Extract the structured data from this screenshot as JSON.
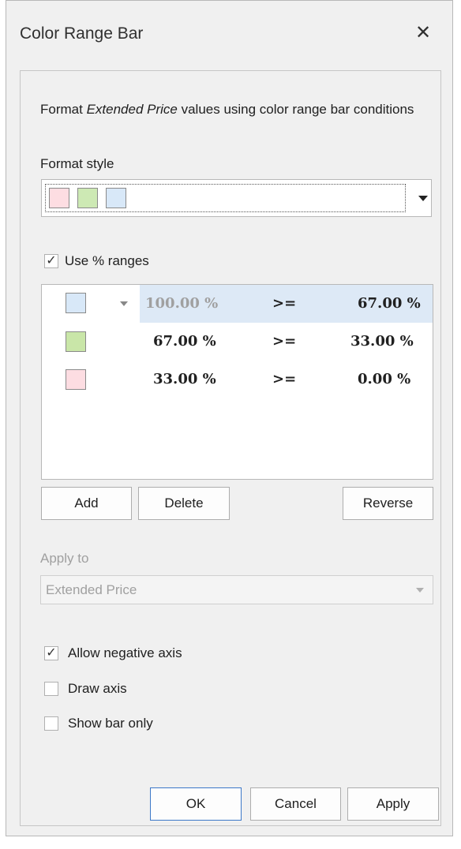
{
  "dialog": {
    "title": "Color Range Bar",
    "close_glyph": "✕"
  },
  "description": {
    "prefix": "Format ",
    "field": "Extended Price",
    "suffix": " values using color range bar conditions"
  },
  "format_style": {
    "label": "Format style",
    "swatches": [
      "#fddde2",
      "#cde9b4",
      "#d8e8f8"
    ]
  },
  "use_percent": {
    "label": "Use % ranges",
    "checked": true
  },
  "ranges": [
    {
      "color": "#d8e8f8",
      "from": "100.00 %",
      "op": ">=",
      "to": "67.00 %",
      "selected": true
    },
    {
      "color": "#c9e6a8",
      "from": "67.00 %",
      "op": ">=",
      "to": "33.00 %",
      "selected": false
    },
    {
      "color": "#fddde2",
      "from": "33.00 %",
      "op": ">=",
      "to": "0.00 %",
      "selected": false
    }
  ],
  "buttons": {
    "add": "Add",
    "delete": "Delete",
    "reverse": "Reverse"
  },
  "apply_to": {
    "label": "Apply to",
    "value": "Extended Price",
    "enabled": false
  },
  "options": [
    {
      "label": "Allow negative axis",
      "checked": true
    },
    {
      "label": "Draw axis",
      "checked": false
    },
    {
      "label": "Show bar only",
      "checked": false
    }
  ],
  "footer": {
    "ok": "OK",
    "cancel": "Cancel",
    "apply": "Apply"
  },
  "colors": {
    "selected_row": "#dde9f6",
    "check_glyph": "✓"
  }
}
